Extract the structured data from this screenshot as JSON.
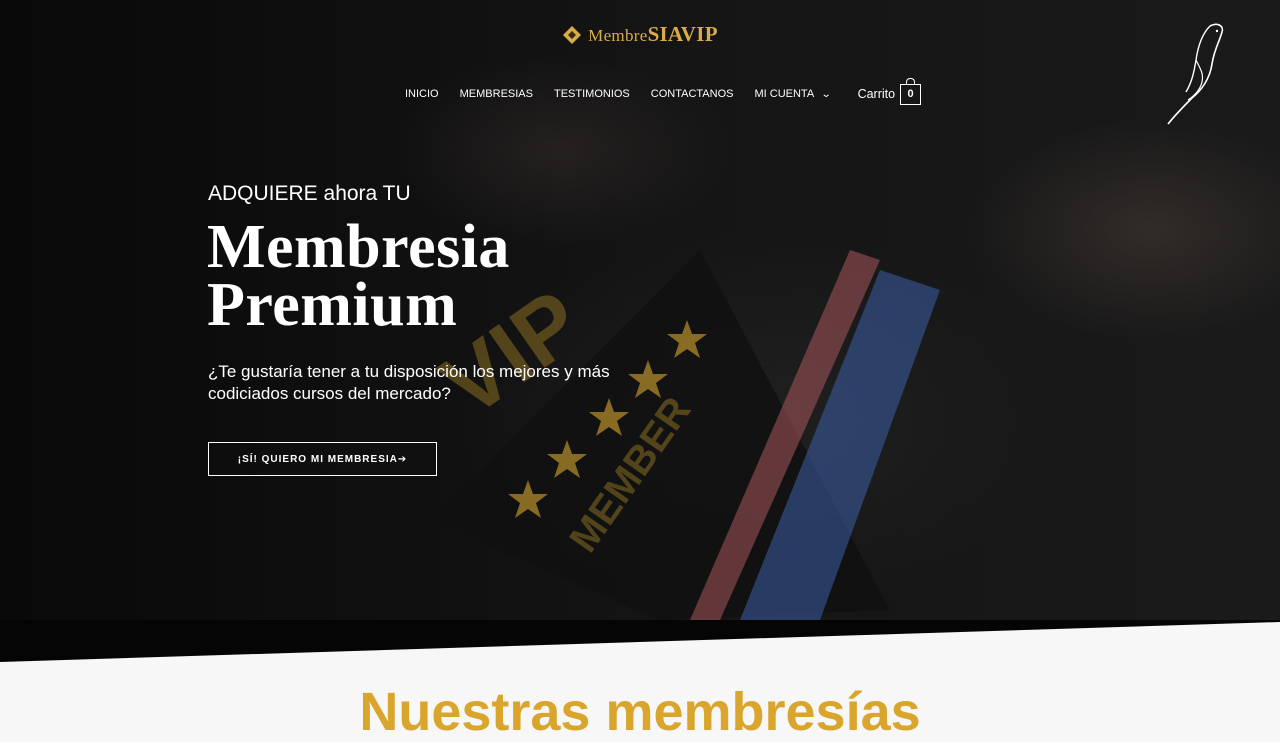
{
  "brand": {
    "logo_light": "Membre",
    "logo_bold": "SIAVIP",
    "accent_color": "#d9ac48"
  },
  "nav": {
    "items": [
      {
        "label": "INICIO"
      },
      {
        "label": "MEMBRESIAS"
      },
      {
        "label": "TESTIMONIOS"
      },
      {
        "label": "CONTACTANOS"
      },
      {
        "label": "MI CUENTA",
        "icon": "chevron-down-icon"
      }
    ],
    "cart_label": "Carrito",
    "cart_count": "0"
  },
  "hero": {
    "kicker": "ADQUIERE ahora TU",
    "headline_line1": "Membresia",
    "headline_line2": "Premium",
    "subtitle": "¿Te gustaría tener a tu disposición los mejores y más codiciados cursos del mercado?",
    "cta_label": "¡SÍ! QUIERO MI MEMBRESIA➔"
  },
  "section": {
    "title": "Nuestras membresías",
    "title_color": "#d9a52c"
  }
}
